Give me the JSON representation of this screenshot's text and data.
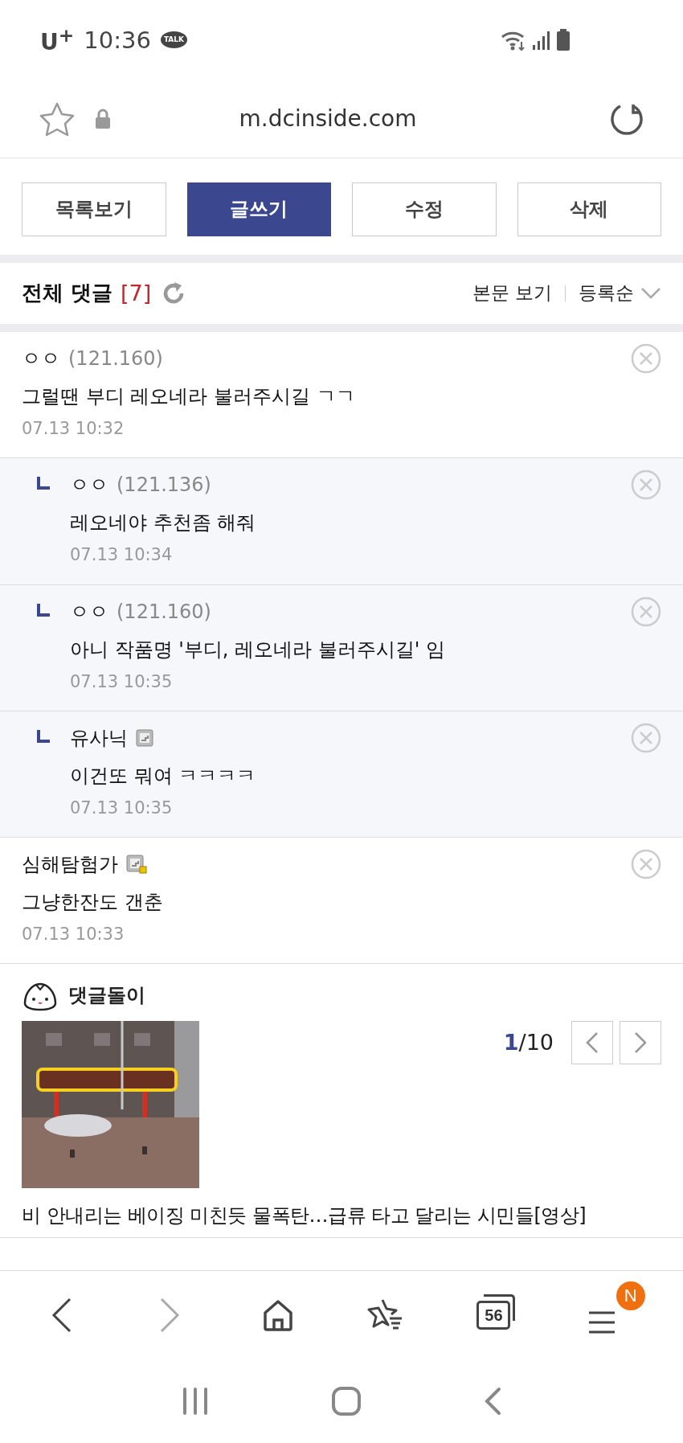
{
  "status_bar": {
    "carrier": "U$^{+}$",
    "time": "10:36",
    "app_badge": "TALK"
  },
  "address_bar": {
    "url": "m.dcinside.com"
  },
  "actions": [
    {
      "label": "목록보기",
      "selected": false
    },
    {
      "label": "글쓰기",
      "selected": true
    },
    {
      "label": "수정",
      "selected": false
    },
    {
      "label": "삭제",
      "selected": false
    }
  ],
  "comments_header": {
    "title": "전체 댓글",
    "count": "[7]",
    "view_body": "본문 보기",
    "sort": "등록순"
  },
  "comments": [
    {
      "author": "ㅇㅇ",
      "ip": "(121.160)",
      "text": "그럴땐 부디 레오네라 불러주시길 ㄱㄱ",
      "date": "07.13 10:32",
      "children": [
        {
          "author": "ㅇㅇ",
          "ip": "(121.136)",
          "text": "레오네야 추천좀 해줘",
          "date": "07.13 10:34"
        },
        {
          "author": "ㅇㅇ",
          "ip": "(121.160)",
          "text": "아니 작품명 '부디, 레오네라 불러주시길' 임",
          "date": "07.13 10:35"
        },
        {
          "author": "유사닉",
          "nick_icon": {
            "kind": "fixed"
          },
          "text": "이건또 뭐여 ㅋㅋㅋㅋ",
          "date": "07.13 10:35"
        }
      ]
    },
    {
      "author": "심해탐험가",
      "nick_icon": {
        "kind": "semi"
      },
      "text": "그냥한잔도 갠춘",
      "date": "07.13 10:33"
    }
  ],
  "comment_bot": {
    "title": "댓글돌이",
    "page_current": "1",
    "page_total": "/10",
    "headline": "비 안내리는 베이징 미친듯 물폭탄…급류 타고 달리는 시민들[영상]"
  },
  "bottom_nav": [
    {
      "kind": "back",
      "disabled": false
    },
    {
      "kind": "forward",
      "disabled": true
    },
    {
      "kind": "home"
    },
    {
      "kind": "bookmarks"
    },
    {
      "kind": "tabs",
      "count": "56"
    },
    {
      "kind": "menu",
      "badge": "N"
    }
  ]
}
